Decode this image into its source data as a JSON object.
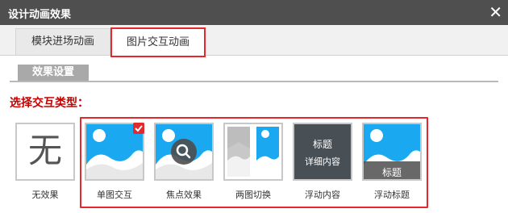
{
  "window": {
    "title": "设计动画效果",
    "close_symbol": "✕"
  },
  "tabs": [
    {
      "label": "模块进场动画",
      "active": false
    },
    {
      "label": "图片交互动画",
      "active": true
    }
  ],
  "section": {
    "tab_label": "效果设置"
  },
  "type_prompt": "选择交互类型：",
  "options": [
    {
      "label": "无效果",
      "glyph": "无",
      "selected": false
    },
    {
      "label": "单图交互",
      "selected": true
    },
    {
      "label": "焦点效果",
      "selected": false
    },
    {
      "label": "两图切换",
      "selected": false
    },
    {
      "label": "浮动内容",
      "overlay_title": "标题",
      "overlay_detail": "详细内容",
      "selected": false
    },
    {
      "label": "浮动标题",
      "overlay_title": "标题",
      "selected": false
    }
  ],
  "colors": {
    "titlebar": "#4f4f4f",
    "highlight_red": "#e5282c",
    "prompt_red": "#c40000",
    "sky_blue": "#1aa9f0",
    "dark_overlay": "#4d4d4d"
  }
}
